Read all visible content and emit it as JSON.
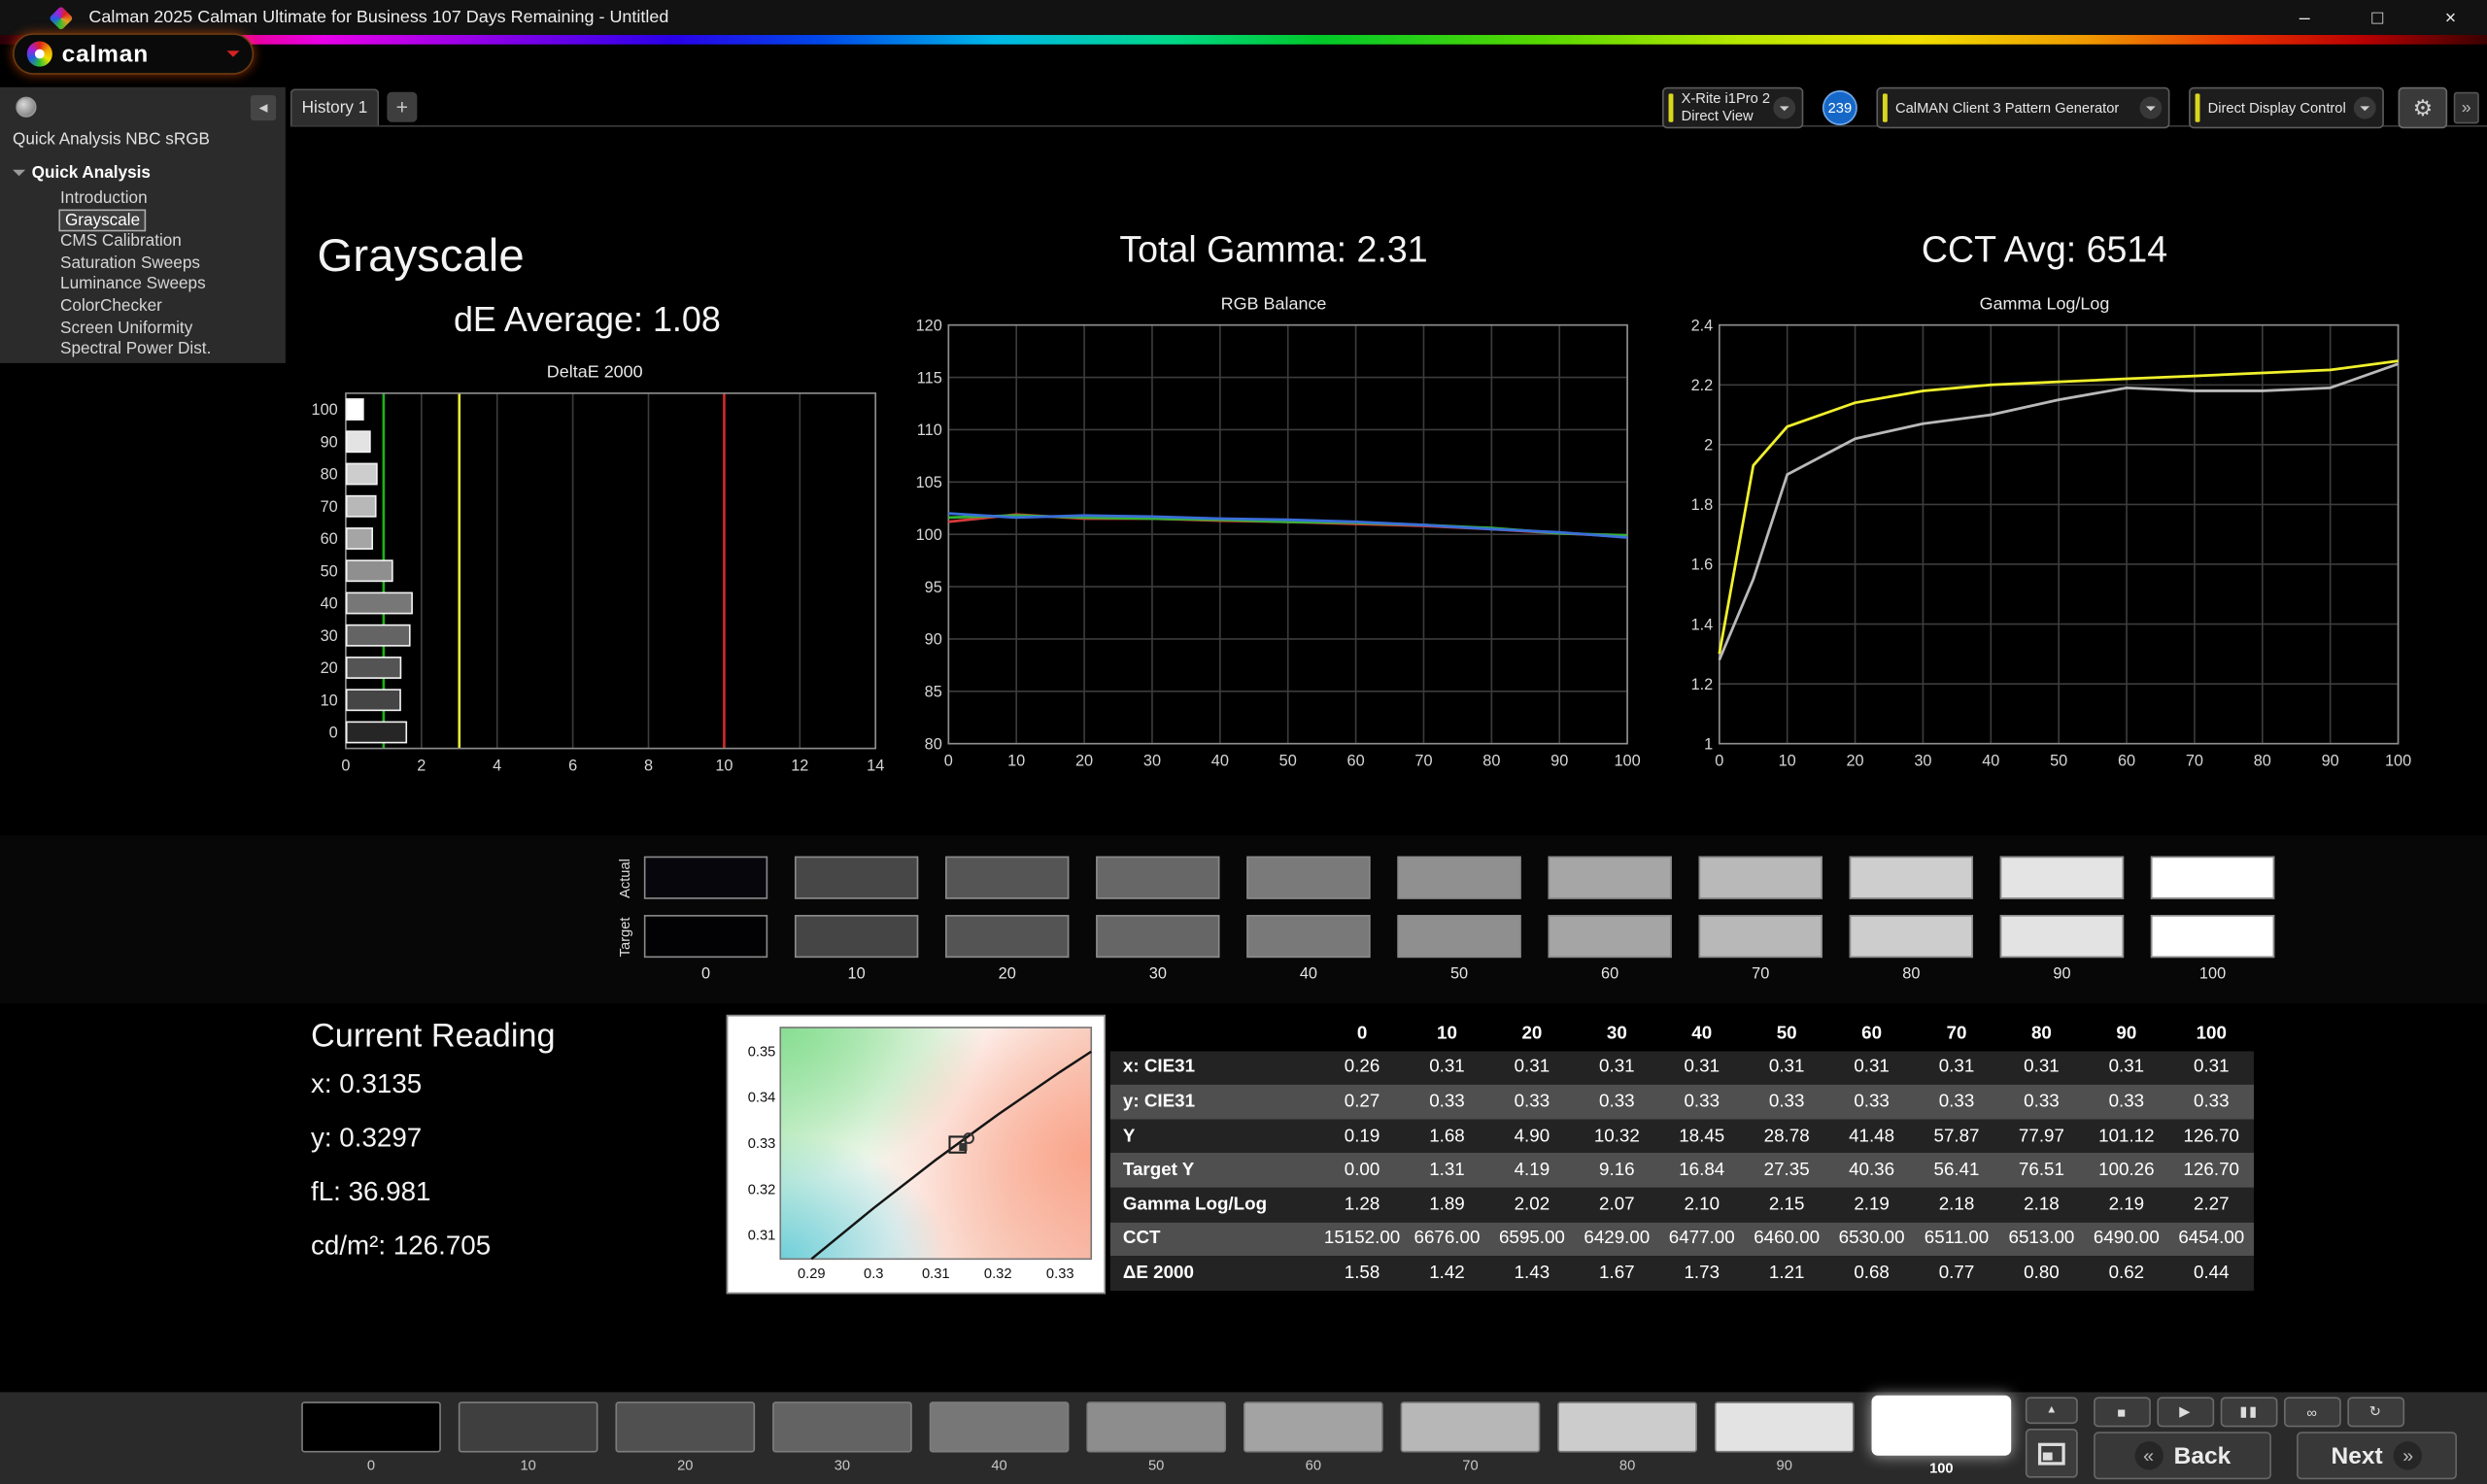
{
  "window": {
    "title": "Calman 2025 Calman Ultimate for Business 107 Days Remaining  - Untitled",
    "controls": {
      "minimize": "–",
      "maximize": "□",
      "close": "×"
    }
  },
  "logo": {
    "text": "calman"
  },
  "sidebar": {
    "header_title": "Quick Analysis NBC sRGB",
    "root_label": "Quick Analysis",
    "items": [
      {
        "label": "Introduction",
        "selected": false
      },
      {
        "label": "Grayscale",
        "selected": true
      },
      {
        "label": "CMS Calibration",
        "selected": false
      },
      {
        "label": "Saturation Sweeps",
        "selected": false
      },
      {
        "label": "Luminance Sweeps",
        "selected": false
      },
      {
        "label": "ColorChecker",
        "selected": false
      },
      {
        "label": "Screen Uniformity",
        "selected": false
      },
      {
        "label": "Spectral Power Dist.",
        "selected": false
      }
    ]
  },
  "tabs": {
    "history_label": "History 1",
    "add_label": "+"
  },
  "toolbar": {
    "meter_line1": "X-Rite i1Pro 2",
    "meter_line2": "Direct View",
    "badge_count": "239",
    "pattern_generator": "CalMAN Client 3 Pattern Generator",
    "display_control": "Direct Display Control",
    "accent_color": "#d8d61e",
    "badge_color": "#1668c8"
  },
  "headings": {
    "grayscale": "Grayscale",
    "de_average": "dE Average: 1.08",
    "total_gamma": "Total Gamma: 2.31",
    "cct_avg": "CCT Avg: 6514"
  },
  "chart_data": [
    {
      "id": "deltae",
      "type": "bar",
      "title": "DeltaE 2000",
      "orientation": "horizontal",
      "categories": [
        100,
        90,
        80,
        70,
        60,
        50,
        40,
        30,
        20,
        10,
        0
      ],
      "values": [
        0.44,
        0.62,
        0.8,
        0.77,
        0.68,
        1.21,
        1.73,
        1.67,
        1.43,
        1.42,
        1.58
      ],
      "bar_colors": [
        "#ffffff",
        "#e3e3e3",
        "#cdcdcd",
        "#b8b8b8",
        "#a5a5a5",
        "#8f8f8f",
        "#777777",
        "#646464",
        "#545454",
        "#454545",
        "#262626"
      ],
      "xlim": [
        0,
        14
      ],
      "x_ticks": [
        0,
        2,
        4,
        6,
        8,
        10,
        12,
        14
      ],
      "ref_lines": [
        {
          "x": 1,
          "color": "#1db31d",
          "meaning": "dE 1 marker"
        },
        {
          "x": 3,
          "color": "#e8e83a",
          "meaning": "dE 3 marker"
        },
        {
          "x": 10,
          "color": "#d42a2a",
          "meaning": "dE 10 marker"
        }
      ]
    },
    {
      "id": "rgb-balance",
      "type": "line",
      "title": "RGB Balance",
      "x": [
        0,
        10,
        20,
        30,
        40,
        50,
        60,
        70,
        80,
        90,
        100
      ],
      "x_ticks": [
        0,
        10,
        20,
        30,
        40,
        50,
        60,
        70,
        80,
        90,
        100
      ],
      "ylim": [
        80,
        120
      ],
      "y_ticks": [
        120,
        115,
        110,
        105,
        100,
        95,
        90,
        85,
        80
      ],
      "series": [
        {
          "name": "red",
          "color": "#d93a3a",
          "values": [
            101.2,
            101.9,
            101.5,
            101.5,
            101.3,
            101.2,
            101.0,
            100.8,
            100.5,
            100.1,
            99.8
          ]
        },
        {
          "name": "green",
          "color": "#35b435",
          "values": [
            101.6,
            101.8,
            101.6,
            101.5,
            101.4,
            101.2,
            101.1,
            100.9,
            100.6,
            100.1,
            99.9
          ]
        },
        {
          "name": "blue",
          "color": "#3a6fd9",
          "values": [
            102.0,
            101.6,
            101.8,
            101.7,
            101.5,
            101.4,
            101.2,
            100.9,
            100.5,
            100.2,
            99.7
          ]
        }
      ]
    },
    {
      "id": "gamma-loglog",
      "type": "line",
      "title": "Gamma Log/Log",
      "x": [
        0,
        5,
        10,
        20,
        30,
        40,
        50,
        60,
        70,
        80,
        90,
        100
      ],
      "x_ticks": [
        0,
        10,
        20,
        30,
        40,
        50,
        60,
        70,
        80,
        90,
        100
      ],
      "ylim": [
        1,
        2.4
      ],
      "y_ticks": [
        2.4,
        2.2,
        2,
        1.8,
        1.6,
        1.4,
        1.2,
        1
      ],
      "series": [
        {
          "name": "target",
          "color": "#f0f02c",
          "values": [
            1.3,
            1.93,
            2.06,
            2.14,
            2.18,
            2.2,
            2.21,
            2.22,
            2.23,
            2.24,
            2.25,
            2.28
          ]
        },
        {
          "name": "measured",
          "color": "#b9b9b9",
          "values": [
            1.28,
            1.55,
            1.9,
            2.02,
            2.07,
            2.1,
            2.15,
            2.19,
            2.18,
            2.18,
            2.19,
            2.27
          ]
        }
      ]
    },
    {
      "id": "cie-detail",
      "type": "scatter",
      "title": "CIE xy detail",
      "xlim": [
        0.285,
        0.335
      ],
      "ylim": [
        0.305,
        0.355
      ],
      "x_ticks": [
        0.29,
        0.3,
        0.31,
        0.32,
        0.33
      ],
      "y_ticks": [
        0.35,
        0.34,
        0.33,
        0.32,
        0.31
      ],
      "locus": [
        [
          0.29,
          0.305
        ],
        [
          0.3,
          0.316
        ],
        [
          0.31,
          0.3264
        ],
        [
          0.32,
          0.3362
        ],
        [
          0.33,
          0.3454
        ],
        [
          0.335,
          0.3498
        ]
      ],
      "points": [
        {
          "x": 0.3135,
          "y": 0.3297
        }
      ]
    }
  ],
  "swatch_strip": {
    "row_labels": [
      "Actual",
      "Target"
    ],
    "levels": [
      "0",
      "10",
      "20",
      "30",
      "40",
      "50",
      "60",
      "70",
      "80",
      "90",
      "100"
    ],
    "actual_colors": [
      "#06060c",
      "#474747",
      "#555555",
      "#676767",
      "#7a7a7a",
      "#909090",
      "#a6a6a6",
      "#b9b9b9",
      "#cecece",
      "#e4e4e4",
      "#ffffff"
    ],
    "target_colors": [
      "#020204",
      "#454545",
      "#545454",
      "#666666",
      "#797979",
      "#8f8f8f",
      "#a5a5a5",
      "#b8b8b8",
      "#cdcdcd",
      "#e3e3e3",
      "#ffffff"
    ]
  },
  "current_reading": {
    "title": "Current Reading",
    "lines": [
      "x: 0.3135",
      "y: 0.3297",
      "fL: 36.981",
      "cd/m²: 126.705"
    ]
  },
  "results_table": {
    "columns": [
      "0",
      "10",
      "20",
      "30",
      "40",
      "50",
      "60",
      "70",
      "80",
      "90",
      "100"
    ],
    "rows": [
      {
        "label": "x: CIE31",
        "values": [
          "0.26",
          "0.31",
          "0.31",
          "0.31",
          "0.31",
          "0.31",
          "0.31",
          "0.31",
          "0.31",
          "0.31",
          "0.31"
        ]
      },
      {
        "label": "y: CIE31",
        "values": [
          "0.27",
          "0.33",
          "0.33",
          "0.33",
          "0.33",
          "0.33",
          "0.33",
          "0.33",
          "0.33",
          "0.33",
          "0.33"
        ]
      },
      {
        "label": "Y",
        "values": [
          "0.19",
          "1.68",
          "4.90",
          "10.32",
          "18.45",
          "28.78",
          "41.48",
          "57.87",
          "77.97",
          "101.12",
          "126.70"
        ]
      },
      {
        "label": "Target Y",
        "values": [
          "0.00",
          "1.31",
          "4.19",
          "9.16",
          "16.84",
          "27.35",
          "40.36",
          "56.41",
          "76.51",
          "100.26",
          "126.70"
        ]
      },
      {
        "label": "Gamma Log/Log",
        "values": [
          "1.28",
          "1.89",
          "2.02",
          "2.07",
          "2.10",
          "2.15",
          "2.19",
          "2.18",
          "2.18",
          "2.19",
          "2.27"
        ]
      },
      {
        "label": "CCT",
        "values": [
          "15152.00",
          "6676.00",
          "6595.00",
          "6429.00",
          "6477.00",
          "6460.00",
          "6530.00",
          "6511.00",
          "6513.00",
          "6490.00",
          "6454.00"
        ]
      },
      {
        "label": "ΔE 2000",
        "values": [
          "1.58",
          "1.42",
          "1.43",
          "1.67",
          "1.73",
          "1.21",
          "0.68",
          "0.77",
          "0.80",
          "0.62",
          "0.44"
        ]
      }
    ]
  },
  "bottom_bar": {
    "patch_labels": [
      "0",
      "10",
      "20",
      "30",
      "40",
      "50",
      "60",
      "70",
      "80",
      "90",
      "100"
    ],
    "patch_colors": [
      "#000000",
      "#3f3f3f",
      "#505050",
      "#636363",
      "#777777",
      "#8d8d8d",
      "#a3a3a3",
      "#b7b7b7",
      "#cccccc",
      "#e3e3e3",
      "#ffffff"
    ],
    "selected": "100",
    "transport": [
      {
        "name": "stop",
        "glyph": "■"
      },
      {
        "name": "play",
        "glyph": "▶"
      },
      {
        "name": "pause",
        "glyph": "▮▮"
      },
      {
        "name": "loop",
        "glyph": "∞"
      },
      {
        "name": "refresh",
        "glyph": "↻"
      }
    ],
    "back_icon": "«",
    "back_label": "Back",
    "next_label": "Next",
    "next_icon": "»"
  }
}
